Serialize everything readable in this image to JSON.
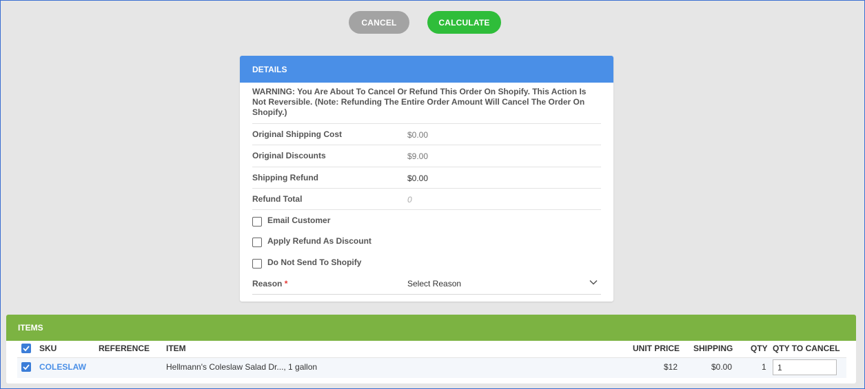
{
  "toolbar": {
    "cancel_label": "CANCEL",
    "calculate_label": "CALCULATE"
  },
  "details": {
    "title": "DETAILS",
    "warning": "WARNING: You Are About To Cancel Or Refund This Order On Shopify. This Action Is Not Reversible. (Note: Refunding The Entire Order Amount Will Cancel The Order On Shopify.)",
    "original_shipping_cost_label": "Original Shipping Cost",
    "original_shipping_cost": "$0.00",
    "original_discounts_label": "Original Discounts",
    "original_discounts": "$9.00",
    "shipping_refund_label": "Shipping Refund",
    "shipping_refund": "$0.00",
    "refund_total_label": "Refund Total",
    "refund_total_placeholder": "0",
    "email_customer_label": "Email Customer",
    "apply_refund_label": "Apply Refund As Discount",
    "do_not_send_label": "Do Not Send To Shopify",
    "reason_label": "Reason",
    "reason_required": "*",
    "reason_value": "Select Reason"
  },
  "items": {
    "title": "ITEMS",
    "columns": {
      "sku": "SKU",
      "reference": "REFERENCE",
      "item": "ITEM",
      "unit_price": "UNIT PRICE",
      "shipping": "SHIPPING",
      "qty": "QTY",
      "qty_to_cancel": "QTY TO CANCEL"
    },
    "rows": [
      {
        "sku": "COLESLAW",
        "reference": "",
        "item": "Hellmann's Coleslaw Salad Dr..., 1 gallon",
        "unit_price": "$12",
        "shipping": "$0.00",
        "qty": "1",
        "qty_to_cancel": "1"
      }
    ]
  },
  "colors": {
    "details_header": "#4a8fe7",
    "items_header": "#7cb342",
    "calculate": "#2fbd3a",
    "cancel": "#a3a3a3",
    "link": "#4a8fe7"
  }
}
